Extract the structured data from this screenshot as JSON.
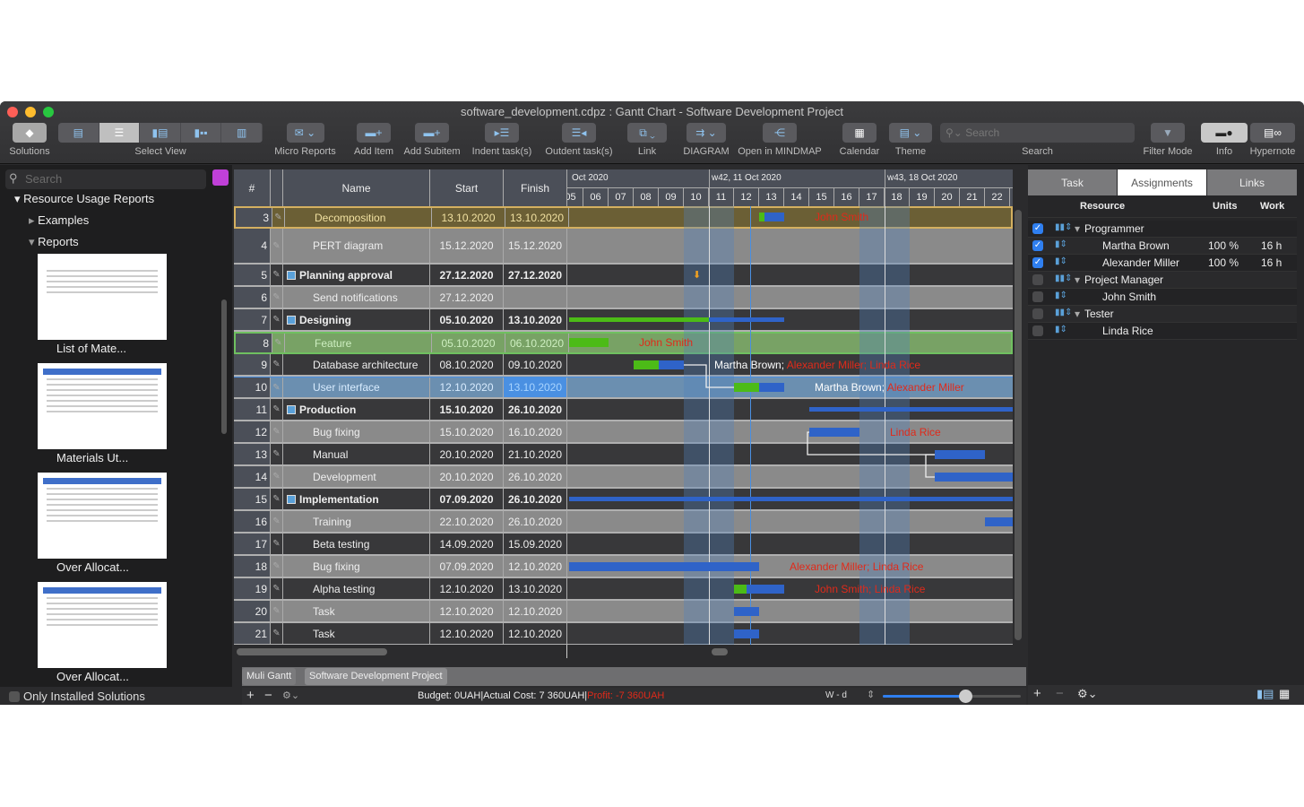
{
  "window": {
    "title": "software_development.cdpz : Gantt Chart - Software Development Project"
  },
  "toolbar": {
    "solutions": "Solutions",
    "select_view": "Select View",
    "micro_reports": "Micro Reports",
    "add_item": "Add Item",
    "add_subitem": "Add Subitem",
    "indent": "Indent task(s)",
    "outdent": "Outdent task(s)",
    "link": "Link",
    "diagram": "DIAGRAM",
    "mindmap": "Open in MINDMAP",
    "calendar": "Calendar",
    "theme": "Theme",
    "search_placeholder": "Search",
    "search_label": "Search",
    "filter_mode": "Filter Mode",
    "info": "Info",
    "hypernote": "Hypernote"
  },
  "sidebar": {
    "search_placeholder": "Search",
    "root": "Resource Usage Reports",
    "examples": "Examples",
    "reports": "Reports",
    "thumbs": [
      "List of Mate...",
      "Materials Ut...",
      "Over Allocat...",
      "Over Allocat..."
    ],
    "only_installed": "Only Installed Solutions"
  },
  "table": {
    "headers": {
      "num": "#",
      "name": "Name",
      "start": "Start",
      "finish": "Finish"
    },
    "rows": [
      {
        "num": "3",
        "name": "Decomposition",
        "start": "13.10.2020",
        "finish": "13.10.2020",
        "style": "olive"
      },
      {
        "num": "4",
        "name": "PERT diagram",
        "start": "15.12.2020",
        "finish": "15.12.2020",
        "style": "gray",
        "tall": true
      },
      {
        "num": "5",
        "name": "Planning approval",
        "start": "27.12.2020",
        "finish": "27.12.2020",
        "style": "dark",
        "summary": true
      },
      {
        "num": "6",
        "name": "Send notifications",
        "start": "27.12.2020",
        "finish": "",
        "style": "gray"
      },
      {
        "num": "7",
        "name": "Designing",
        "start": "05.10.2020",
        "finish": "13.10.2020",
        "style": "dark",
        "summary": true
      },
      {
        "num": "8",
        "name": "Feature",
        "start": "05.10.2020",
        "finish": "06.10.2020",
        "style": "green"
      },
      {
        "num": "9",
        "name": "Database architecture",
        "start": "08.10.2020",
        "finish": "09.10.2020",
        "style": "dark"
      },
      {
        "num": "10",
        "name": "User interface",
        "start": "12.10.2020",
        "finish": "13.10.2020",
        "style": "blue"
      },
      {
        "num": "11",
        "name": "Production",
        "start": "15.10.2020",
        "finish": "26.10.2020",
        "style": "dark",
        "summary": true
      },
      {
        "num": "12",
        "name": "Bug fixing",
        "start": "15.10.2020",
        "finish": "16.10.2020",
        "style": "gray"
      },
      {
        "num": "13",
        "name": "Manual",
        "start": "20.10.2020",
        "finish": "21.10.2020",
        "style": "dark"
      },
      {
        "num": "14",
        "name": "Development",
        "start": "20.10.2020",
        "finish": "26.10.2020",
        "style": "gray"
      },
      {
        "num": "15",
        "name": "Implementation",
        "start": "07.09.2020",
        "finish": "26.10.2020",
        "style": "dark",
        "summary": true
      },
      {
        "num": "16",
        "name": "Training",
        "start": "22.10.2020",
        "finish": "26.10.2020",
        "style": "gray"
      },
      {
        "num": "17",
        "name": "Beta testing",
        "start": "14.09.2020",
        "finish": "15.09.2020",
        "style": "dark"
      },
      {
        "num": "18",
        "name": "Bug fixing",
        "start": "07.09.2020",
        "finish": "12.10.2020",
        "style": "gray"
      },
      {
        "num": "19",
        "name": "Alpha testing",
        "start": "12.10.2020",
        "finish": "13.10.2020",
        "style": "dark"
      },
      {
        "num": "20",
        "name": "Task",
        "start": "12.10.2020",
        "finish": "12.10.2020",
        "style": "gray"
      },
      {
        "num": "21",
        "name": "Task",
        "start": "12.10.2020",
        "finish": "12.10.2020",
        "style": "dark"
      }
    ]
  },
  "timeline": {
    "months": [
      "Oct 2020",
      "w42, 11 Oct 2020",
      "w43, 18 Oct 2020"
    ],
    "days": [
      "05",
      "06",
      "07",
      "08",
      "09",
      "10",
      "11",
      "12",
      "13",
      "14",
      "15",
      "16",
      "17",
      "18",
      "19",
      "20",
      "21",
      "22"
    ]
  },
  "bars": [
    {
      "row": 0,
      "from": 13,
      "to": 14,
      "progress": 0.2,
      "white": "",
      "red": "John Smith"
    },
    {
      "row": 2,
      "milestone": 10.5
    },
    {
      "row": 4,
      "from": 5,
      "to": 14,
      "progress": 0.65,
      "summary": true
    },
    {
      "row": 5,
      "from": 5.4,
      "to": 7,
      "progress": 1,
      "white": "",
      "red": "John Smith"
    },
    {
      "row": 6,
      "from": 8,
      "to": 10,
      "progress": 0.5,
      "white": "Martha Brown; ",
      "red": "Alexander Miller; Linda Rice"
    },
    {
      "row": 7,
      "from": 12,
      "to": 14,
      "progress": 0.5,
      "white": "Martha Brown; ",
      "red": "Alexander Miller"
    },
    {
      "row": 8,
      "from": 15,
      "to": 30,
      "progress": 0,
      "summary": true
    },
    {
      "row": 9,
      "from": 15,
      "to": 17,
      "progress": 0,
      "white": "",
      "red": "Linda Rice"
    },
    {
      "row": 10,
      "from": 20,
      "to": 22,
      "progress": 0
    },
    {
      "row": 11,
      "from": 20,
      "to": 30,
      "progress": 0
    },
    {
      "row": 12,
      "from": 1,
      "to": 30,
      "progress": 0,
      "summary": true
    },
    {
      "row": 13,
      "from": 22,
      "to": 30,
      "progress": 0
    },
    {
      "row": 15,
      "from": 5,
      "to": 13,
      "progress": 0,
      "white": "",
      "red": "Alexander Miller; Linda Rice"
    },
    {
      "row": 16,
      "from": 12,
      "to": 14,
      "progress": 0.25,
      "white": "",
      "red": "John Smith; Linda Rice"
    },
    {
      "row": 17,
      "from": 12,
      "to": 13,
      "progress": 0
    },
    {
      "row": 18,
      "from": 12,
      "to": 13,
      "progress": 0
    }
  ],
  "bottom": {
    "tabs": [
      "Muli Gantt",
      "Software Development Project"
    ],
    "budget": "Budget: 0UAH|Actual Cost: 7 360UAH|",
    "profit": "Profit: -7 360UAH",
    "scale": "W - d",
    "zoom_level": 0.6
  },
  "assignments": {
    "tabs": [
      "Task",
      "Assignments",
      "Links"
    ],
    "headers": {
      "resource": "Resource",
      "units": "Units",
      "work": "Work"
    },
    "rows": [
      {
        "group": true,
        "name": "Programmer",
        "checked": true,
        "units": "",
        "work": ""
      },
      {
        "name": "Martha Brown",
        "checked": true,
        "units": "100 %",
        "work": "16 h"
      },
      {
        "name": "Alexander Miller",
        "checked": true,
        "units": "100 %",
        "work": "16 h"
      },
      {
        "group": true,
        "name": "Project Manager",
        "checked": false,
        "units": "",
        "work": ""
      },
      {
        "name": "John Smith",
        "checked": false,
        "units": "",
        "work": ""
      },
      {
        "group": true,
        "name": "Tester",
        "checked": false,
        "units": "",
        "work": ""
      },
      {
        "name": "Linda Rice",
        "checked": false,
        "units": "",
        "work": ""
      }
    ]
  },
  "colors": {
    "bar": "#2f63c8",
    "progress": "#4cbb17",
    "label_red": "#e02a1a",
    "accent": "#2f7ff0"
  }
}
